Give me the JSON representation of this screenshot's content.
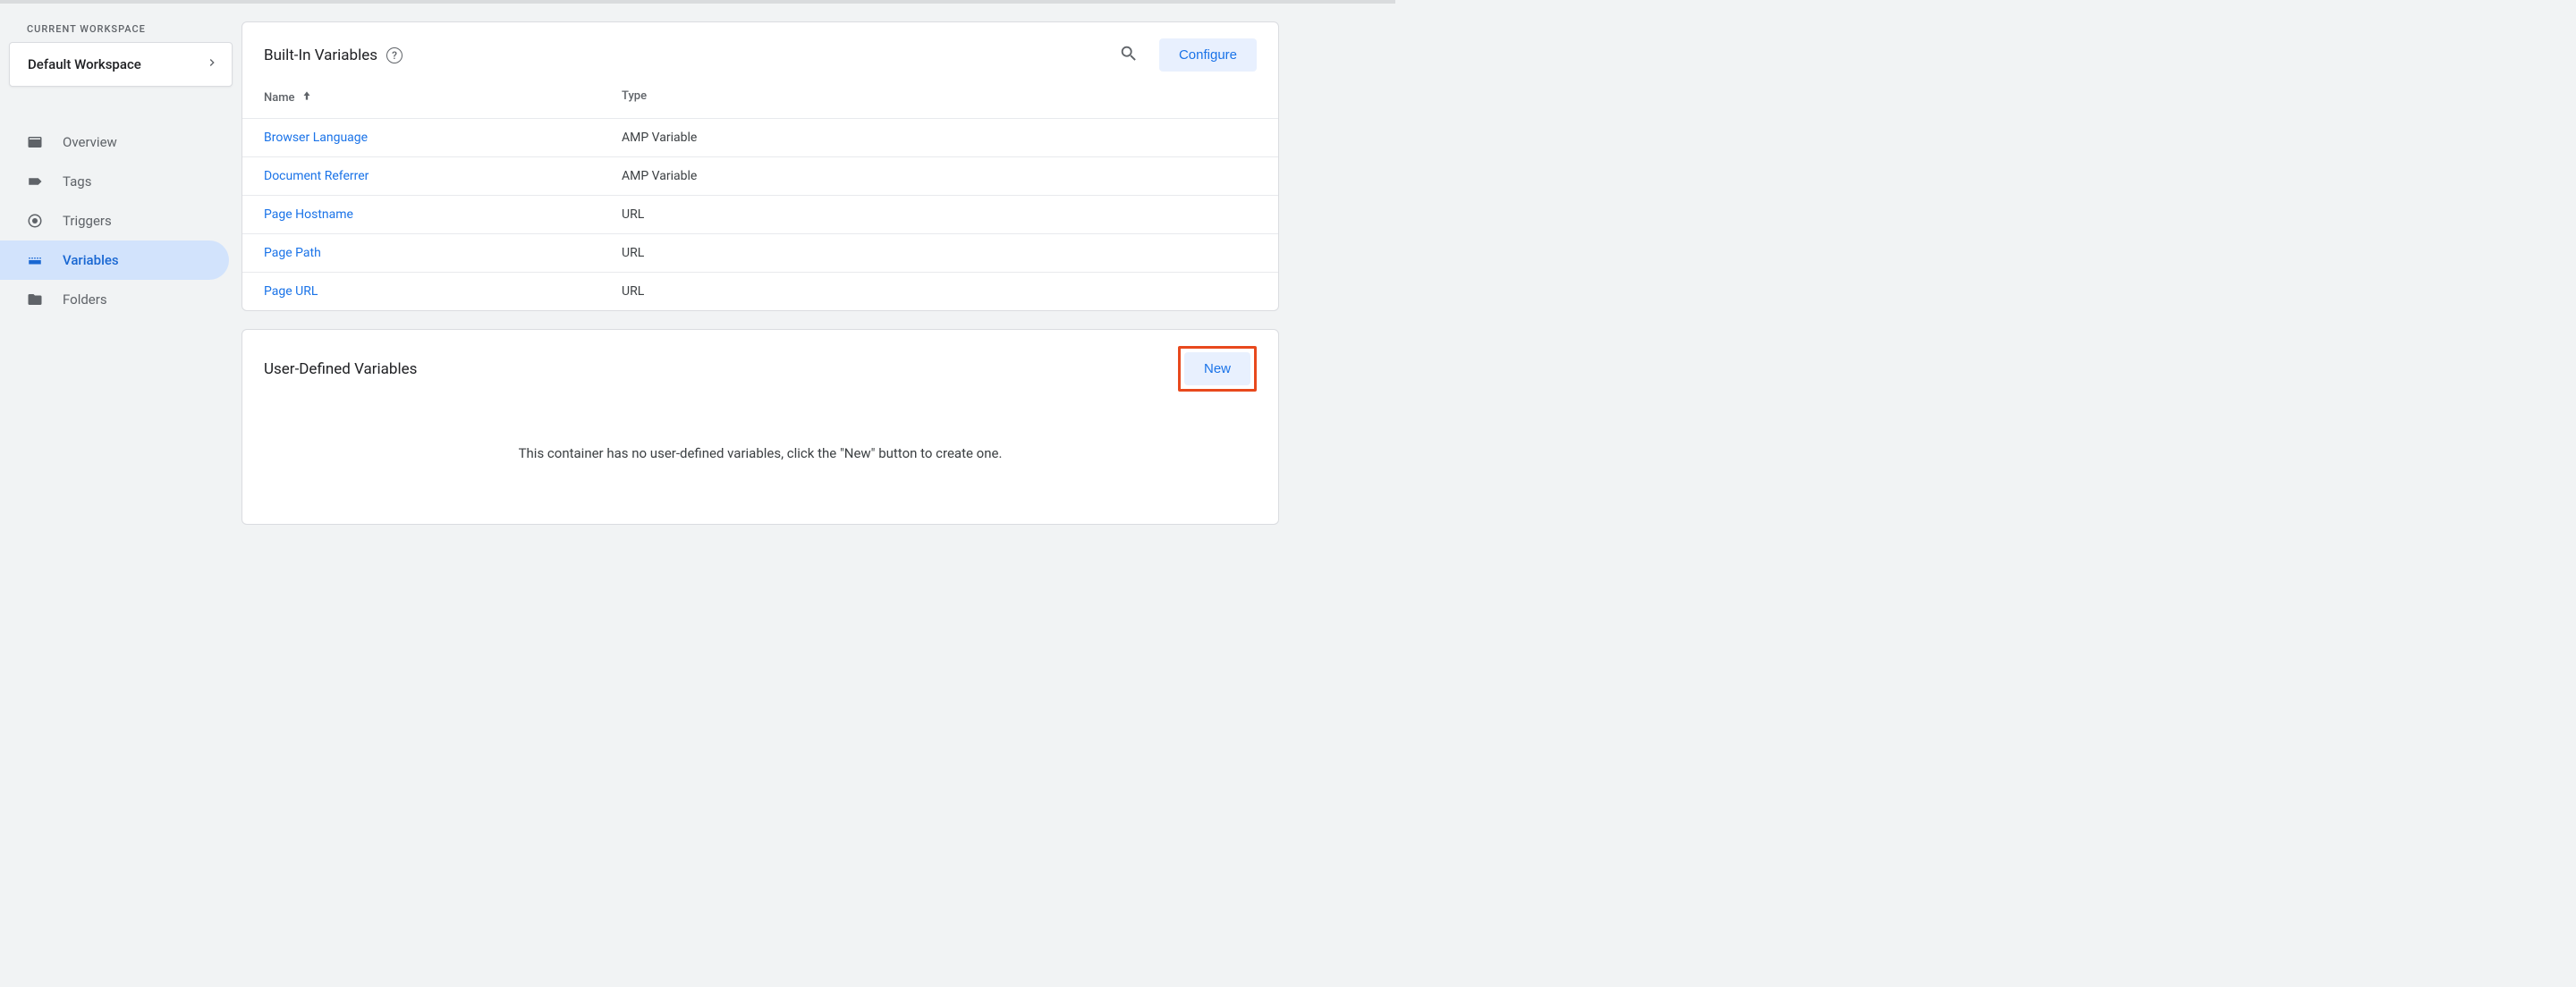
{
  "sidebar": {
    "workspace_label": "CURRENT WORKSPACE",
    "workspace_name": "Default Workspace",
    "nav": [
      {
        "label": "Overview",
        "icon": "overview"
      },
      {
        "label": "Tags",
        "icon": "tags"
      },
      {
        "label": "Triggers",
        "icon": "triggers"
      },
      {
        "label": "Variables",
        "icon": "variables",
        "active": true
      },
      {
        "label": "Folders",
        "icon": "folders"
      }
    ]
  },
  "builtin": {
    "title": "Built-In Variables",
    "configure_label": "Configure",
    "columns": {
      "name": "Name",
      "type": "Type"
    },
    "rows": [
      {
        "name": "Browser Language",
        "type": "AMP Variable"
      },
      {
        "name": "Document Referrer",
        "type": "AMP Variable"
      },
      {
        "name": "Page Hostname",
        "type": "URL"
      },
      {
        "name": "Page Path",
        "type": "URL"
      },
      {
        "name": "Page URL",
        "type": "URL"
      }
    ]
  },
  "userdef": {
    "title": "User-Defined Variables",
    "new_label": "New",
    "empty_message": "This container has no user-defined variables, click the \"New\" button to create one."
  }
}
